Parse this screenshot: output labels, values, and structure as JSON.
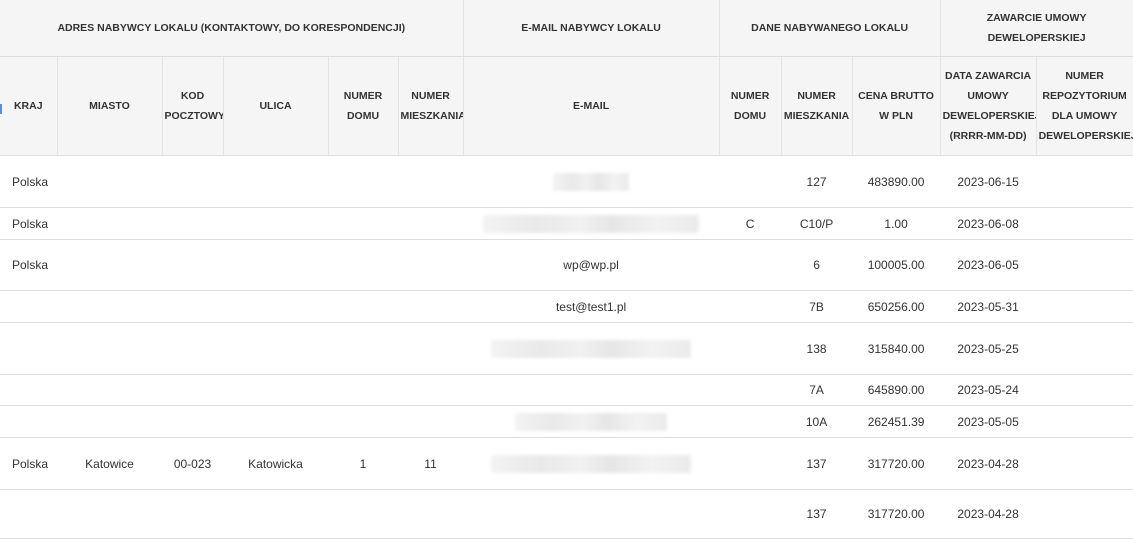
{
  "header": {
    "groups": [
      "ADRES NABYWCY LOKALU (KONTAKTOWY, DO KORESPONDENCJI)",
      "E-MAIL NABYWCY LOKALU",
      "DANE NABYWANEGO LOKALU",
      "ZAWARCIE UMOWY DEWELOPERSKIEJ"
    ],
    "columns": [
      "KRAJ",
      "MIASTO",
      "KOD POCZTOWY",
      "ULICA",
      "NUMER DOMU",
      "NUMER MIESZKANIA",
      "E-MAIL",
      "NUMER DOMU",
      "NUMER MIESZKANIA",
      "CENA BRUTTO W PLN",
      "DATA ZAWARCIA UMOWY DEWELOPERSKIEJ (RRRR-MM-DD)",
      "NUMER REPOZYTORIUM DLA UMOWY DEWELOPERSKIEJ"
    ]
  },
  "rows": [
    {
      "kraj": "Polska",
      "miasto": "",
      "kod": "",
      "ulica": "",
      "nr_domu": "",
      "nr_mieszkania": "",
      "email": "",
      "email_blurred": true,
      "lok_nr_domu": "",
      "lok_nr_mieszkania": "127",
      "cena": "483890.00",
      "data": "2023-06-15",
      "repozytorium": ""
    },
    {
      "kraj": "Polska",
      "miasto": "",
      "kod": "",
      "ulica": "",
      "nr_domu": "",
      "nr_mieszkania": "",
      "email": "",
      "email_blurred": true,
      "lok_nr_domu": "C",
      "lok_nr_mieszkania": "C10/P",
      "cena": "1.00",
      "data": "2023-06-08",
      "repozytorium": ""
    },
    {
      "kraj": "Polska",
      "miasto": "",
      "kod": "",
      "ulica": "",
      "nr_domu": "",
      "nr_mieszkania": "",
      "email": "wp@wp.pl",
      "email_blurred": false,
      "lok_nr_domu": "",
      "lok_nr_mieszkania": "6",
      "cena": "100005.00",
      "data": "2023-06-05",
      "repozytorium": ""
    },
    {
      "kraj": "",
      "miasto": "",
      "kod": "",
      "ulica": "",
      "nr_domu": "",
      "nr_mieszkania": "",
      "email": "test@test1.pl",
      "email_blurred": false,
      "lok_nr_domu": "",
      "lok_nr_mieszkania": "7B",
      "cena": "650256.00",
      "data": "2023-05-31",
      "repozytorium": ""
    },
    {
      "kraj": "",
      "miasto": "",
      "kod": "",
      "ulica": "",
      "nr_domu": "",
      "nr_mieszkania": "",
      "email": "",
      "email_blurred": true,
      "lok_nr_domu": "",
      "lok_nr_mieszkania": "138",
      "cena": "315840.00",
      "data": "2023-05-25",
      "repozytorium": ""
    },
    {
      "kraj": "",
      "miasto": "",
      "kod": "",
      "ulica": "",
      "nr_domu": "",
      "nr_mieszkania": "",
      "email": "",
      "email_blurred": false,
      "lok_nr_domu": "",
      "lok_nr_mieszkania": "7A",
      "cena": "645890.00",
      "data": "2023-05-24",
      "repozytorium": ""
    },
    {
      "kraj": "",
      "miasto": "",
      "kod": "",
      "ulica": "",
      "nr_domu": "",
      "nr_mieszkania": "",
      "email": "",
      "email_blurred": true,
      "lok_nr_domu": "",
      "lok_nr_mieszkania": "10A",
      "cena": "262451.39",
      "data": "2023-05-05",
      "repozytorium": ""
    },
    {
      "kraj": "Polska",
      "miasto": "Katowice",
      "kod": "00-023",
      "ulica": "Katowicka",
      "nr_domu": "1",
      "nr_mieszkania": "11",
      "email": "",
      "email_blurred": true,
      "lok_nr_domu": "",
      "lok_nr_mieszkania": "137",
      "cena": "317720.00",
      "data": "2023-04-28",
      "repozytorium": ""
    },
    {
      "kraj": "",
      "miasto": "",
      "kod": "",
      "ulica": "",
      "nr_domu": "",
      "nr_mieszkania": "",
      "email": "",
      "email_blurred": false,
      "lok_nr_domu": "",
      "lok_nr_mieszkania": "137",
      "cena": "317720.00",
      "data": "2023-04-28",
      "repozytorium": ""
    }
  ],
  "colors": {
    "header_bg": "#f5f5f5",
    "border": "#dddddd",
    "text": "#333333",
    "edge_accent": "#5a8fd8"
  }
}
